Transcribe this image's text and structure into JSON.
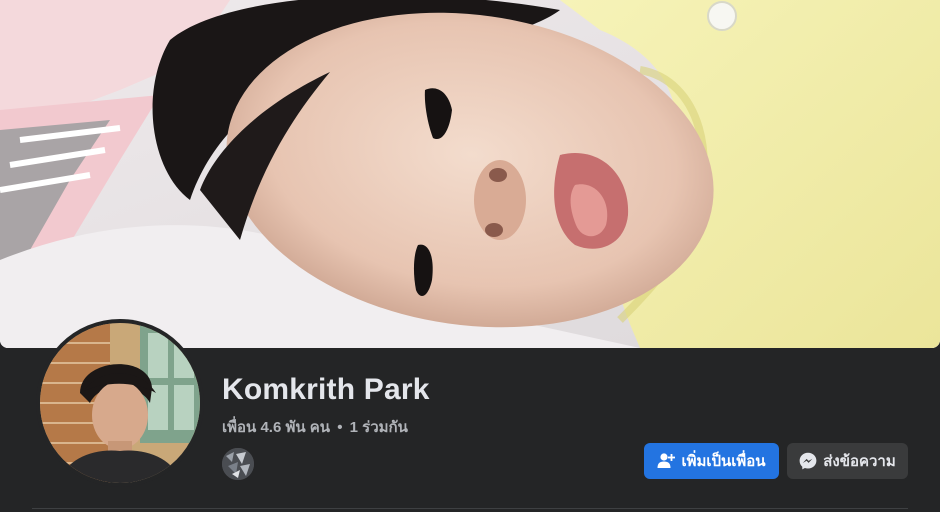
{
  "profile": {
    "name": "Komkrith Park",
    "friends_summary": "เพื่อน 4.6 พัน คน",
    "separator": "•",
    "mutual_summary": "1 ร่วมกัน"
  },
  "cover": {
    "icon": "cover-photo"
  },
  "actions": {
    "add_friend_label": "เพิ่มเป็นเพื่อน",
    "add_friend_icon": "add-friend-icon",
    "message_label": "ส่งข้อความ",
    "message_icon": "messenger-icon"
  },
  "colors": {
    "background": "#242526",
    "primary_button": "#2374e1",
    "secondary_button": "#3a3b3c",
    "text_primary": "#e4e6eb",
    "text_secondary": "#b0b3b8"
  }
}
